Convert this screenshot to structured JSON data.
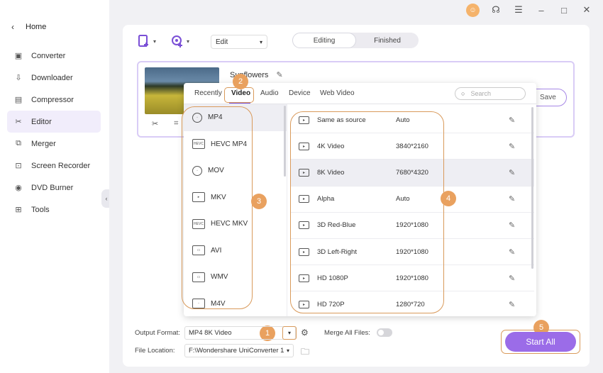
{
  "sidebar": {
    "home": "Home",
    "items": [
      {
        "label": "Converter",
        "icon": "converter-icon"
      },
      {
        "label": "Downloader",
        "icon": "downloader-icon"
      },
      {
        "label": "Compressor",
        "icon": "compressor-icon"
      },
      {
        "label": "Editor",
        "icon": "scissors-icon",
        "active": true
      },
      {
        "label": "Merger",
        "icon": "merger-icon"
      },
      {
        "label": "Screen Recorder",
        "icon": "screen-recorder-icon"
      },
      {
        "label": "DVD Burner",
        "icon": "dvd-icon"
      },
      {
        "label": "Tools",
        "icon": "tools-icon"
      }
    ]
  },
  "toolbar": {
    "edit_select": "Edit",
    "tabs": [
      "Editing",
      "Finished"
    ],
    "active_tab": "Editing"
  },
  "file": {
    "name": "Sunflowers",
    "save_label": "Save"
  },
  "popup": {
    "tabs": [
      "Recently",
      "Video",
      "Audio",
      "Device",
      "Web Video"
    ],
    "active_tab": "Video",
    "search_placeholder": "Search",
    "formats": [
      {
        "label": "MP4",
        "icon": "mp4-icon"
      },
      {
        "label": "HEVC MP4",
        "icon": "hevc-icon"
      },
      {
        "label": "MOV",
        "icon": "mov-icon"
      },
      {
        "label": "MKV",
        "icon": "mkv-icon"
      },
      {
        "label": "HEVC MKV",
        "icon": "hevc-icon"
      },
      {
        "label": "AVI",
        "icon": "avi-icon"
      },
      {
        "label": "WMV",
        "icon": "wmv-icon"
      },
      {
        "label": "M4V",
        "icon": "m4v-icon"
      }
    ],
    "resolutions": [
      {
        "name": "Same as source",
        "value": "Auto"
      },
      {
        "name": "4K Video",
        "value": "3840*2160"
      },
      {
        "name": "8K Video",
        "value": "7680*4320"
      },
      {
        "name": "Alpha",
        "value": "Auto"
      },
      {
        "name": "3D Red-Blue",
        "value": "1920*1080"
      },
      {
        "name": "3D Left-Right",
        "value": "1920*1080"
      },
      {
        "name": "HD 1080P",
        "value": "1920*1080"
      },
      {
        "name": "HD 720P",
        "value": "1280*720"
      }
    ]
  },
  "bottom": {
    "output_format_label": "Output Format:",
    "output_format_value": "MP4 8K Video",
    "merge_label": "Merge All Files:",
    "file_location_label": "File Location:",
    "file_location_value": "F:\\Wondershare UniConverter 1",
    "start_all": "Start All"
  },
  "badges": [
    "1",
    "2",
    "3",
    "4",
    "5"
  ],
  "colors": {
    "accent": "#9b6ce8",
    "annotation": "#e9a15f"
  }
}
